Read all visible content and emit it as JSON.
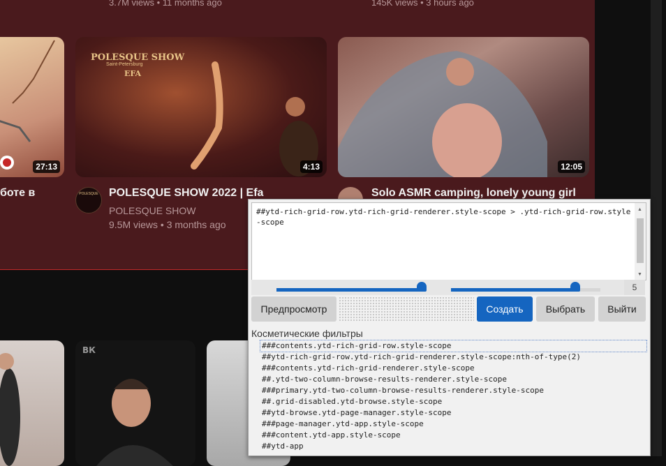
{
  "top_row": {
    "meta_left": "3.7M views • 11 months ago",
    "meta_right": "145K views • 3 hours ago"
  },
  "videos": [
    {
      "title": "ботe в",
      "duration": "27:13"
    },
    {
      "title": "POLESQUE SHOW 2022 | Efa",
      "channel": "POLESQUE SHOW",
      "meta": "9.5M views • 3 months ago",
      "duration": "4:13",
      "overlay_title": "POLESQUE SHOW",
      "overlay_sub": "Saint-Petersburg",
      "overlay_name": "EFA",
      "avatar_text": "POLESQUE"
    },
    {
      "title": "Solo ASMR camping, lonely young girl",
      "duration": "12:05"
    }
  ],
  "picker": {
    "selector": "##ytd-rich-grid-row.ytd-rich-grid-renderer.style-scope > .ytd-rich-grid-row.style-scope",
    "slider1_value": 0.97,
    "slider2_value": 0.83,
    "count": "5",
    "buttons": {
      "preview": "Предпросмотр",
      "create": "Создать",
      "pick": "Выбрать",
      "exit": "Выйти"
    },
    "cosmetic_label": "Косметические фильтры",
    "filters": [
      "###contents.ytd-rich-grid-row.style-scope",
      "##ytd-rich-grid-row.ytd-rich-grid-renderer.style-scope:nth-of-type(2)",
      "###contents.ytd-rich-grid-renderer.style-scope",
      "##.ytd-two-column-browse-results-renderer.style-scope",
      "###primary.ytd-two-column-browse-results-renderer.style-scope",
      "##.grid-disabled.ytd-browse.style-scope",
      "##ytd-browse.ytd-page-manager.style-scope",
      "###page-manager.ytd-app.style-scope",
      "###content.ytd-app.style-scope",
      "##ytd-app"
    ]
  }
}
